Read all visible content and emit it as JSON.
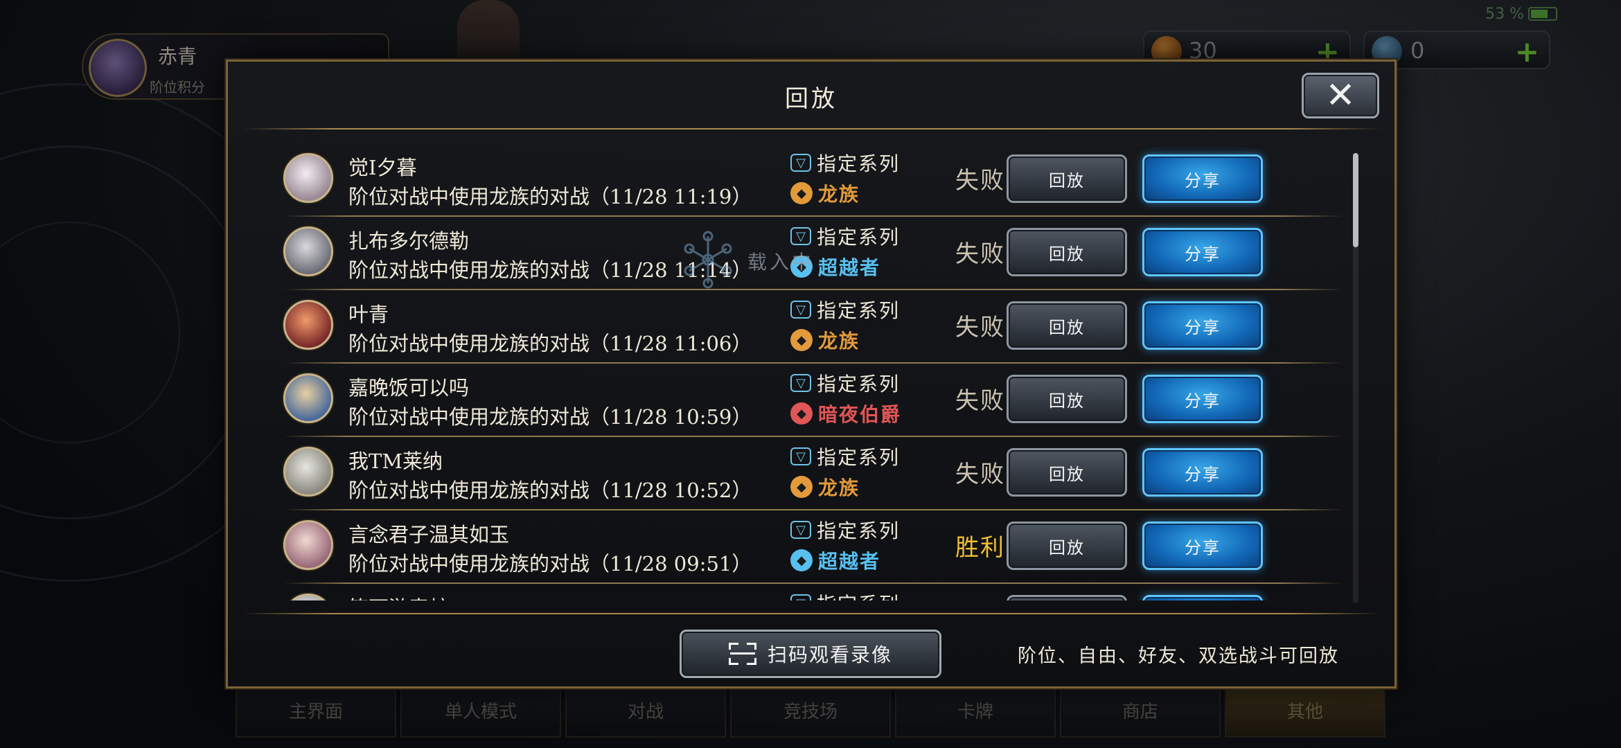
{
  "status_bar": {
    "battery_text": "53 %"
  },
  "player": {
    "name": "赤青",
    "sub": "阶位积分"
  },
  "currency": [
    {
      "icon": "crystal-icon",
      "value": "30",
      "plus": "+"
    },
    {
      "icon": "rupie-icon",
      "value": "0",
      "plus": "+"
    }
  ],
  "dialog": {
    "title": "回放",
    "close_label": "✕",
    "scan_label": "扫码观看录像",
    "footnote": "阶位、自由、好友、双选战斗可回放",
    "loading_text": "载入中",
    "replays": [
      {
        "name": "觉I夕暮",
        "desc": "阶位对战中使用龙族的对战（11/28 11:19）",
        "format": "指定系列",
        "class": "龙族",
        "class_icon": "dragon-class-icon",
        "class_color": "#e39a3b",
        "result": "失败",
        "win": false,
        "replay": "回放",
        "share": "分享"
      },
      {
        "name": "扎布多尔德勒",
        "desc": "阶位对战中使用龙族的对战（11/28 11:14）",
        "format": "指定系列",
        "class": "超越者",
        "class_icon": "portal-class-icon",
        "class_color": "#58c0f0",
        "result": "失败",
        "win": false,
        "replay": "回放",
        "share": "分享"
      },
      {
        "name": "叶青",
        "desc": "阶位对战中使用龙族的对战（11/28 11:06）",
        "format": "指定系列",
        "class": "龙族",
        "class_icon": "dragon-class-icon",
        "class_color": "#e39a3b",
        "result": "失败",
        "win": false,
        "replay": "回放",
        "share": "分享"
      },
      {
        "name": "嘉晚饭可以吗",
        "desc": "阶位对战中使用龙族的对战（11/28 10:59）",
        "format": "指定系列",
        "class": "暗夜伯爵",
        "class_icon": "blood-class-icon",
        "class_color": "#e05656",
        "result": "失败",
        "win": false,
        "replay": "回放",
        "share": "分享"
      },
      {
        "name": "我TM莱纳",
        "desc": "阶位对战中使用龙族的对战（11/28 10:52）",
        "format": "指定系列",
        "class": "龙族",
        "class_icon": "dragon-class-icon",
        "class_color": "#e39a3b",
        "result": "失败",
        "win": false,
        "replay": "回放",
        "share": "分享"
      },
      {
        "name": "言念君子温其如玉",
        "desc": "阶位对战中使用龙族的对战（11/28 09:51）",
        "format": "指定系列",
        "class": "超越者",
        "class_icon": "portal-class-icon",
        "class_color": "#58c0f0",
        "result": "胜利",
        "win": true,
        "replay": "回放",
        "share": "分享"
      },
      {
        "name": "笑下游毒蛇",
        "desc": "",
        "format": "指定系列",
        "class": "",
        "class_icon": "",
        "class_color": "#e39a3b",
        "result": "",
        "win": false,
        "replay": "",
        "share": ""
      }
    ]
  },
  "bottom_nav": [
    "主界面",
    "单人模式",
    "对战",
    "竞技场",
    "卡牌",
    "商店",
    "其他"
  ]
}
